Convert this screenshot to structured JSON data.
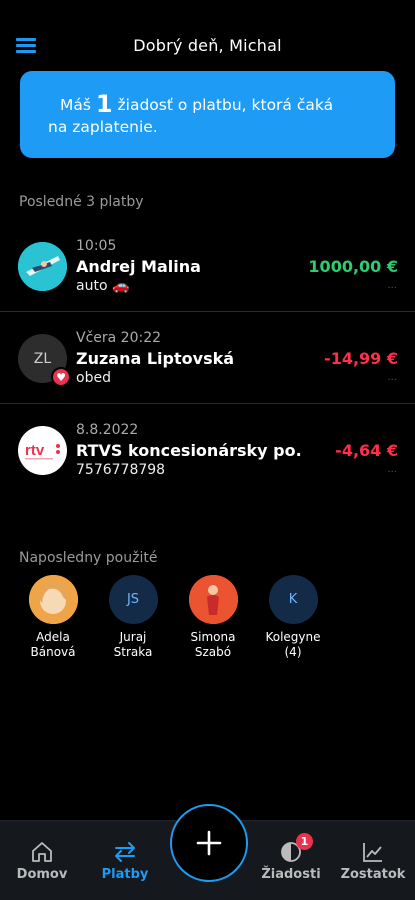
{
  "header": {
    "greeting": "Dobrý deň, Michal",
    "menu_icon": "hamburger-icon"
  },
  "banner": {
    "prefix": "Máš",
    "count": "1",
    "suffix": "žiadosť o platbu, ktorá čaká",
    "line2": "na zaplatenie."
  },
  "payments": {
    "title": "Posledné 3 platby",
    "items": [
      {
        "time": "10:05",
        "name": "Andrej Malina",
        "note": "auto 🚗",
        "amount": "1000,00 €",
        "direction": "in"
      },
      {
        "time": "Včera 20:22",
        "name": "Zuzana Liptovská",
        "note": "obed",
        "amount": "-14,99 €",
        "initials": "ZL",
        "direction": "out"
      },
      {
        "time": "8.8.2022",
        "name": "RTVS koncesionársky po.",
        "note": "7576778798",
        "amount": "-4,64 €",
        "direction": "out"
      }
    ]
  },
  "recent": {
    "title": "Naposledny použité",
    "contacts": [
      {
        "name1": "Adela",
        "name2": "Bánová"
      },
      {
        "initials": "JS",
        "name1": "Juraj",
        "name2": "Straka"
      },
      {
        "name1": "Simona",
        "name2": "Szabó"
      },
      {
        "initials": "K",
        "name1": "Kolegyne",
        "name2": "(4)"
      }
    ]
  },
  "nav": {
    "items": [
      {
        "label": "Domov",
        "icon": "home-icon"
      },
      {
        "label": "Platby",
        "icon": "transfer-arrows-icon",
        "active": true
      },
      {
        "label": "Žiadosti",
        "icon": "requests-icon",
        "badge": "1"
      },
      {
        "label": "Zostatok",
        "icon": "chart-line-icon"
      }
    ],
    "fab_icon": "plus-icon"
  },
  "colors": {
    "accent": "#1e9bf5",
    "positive": "#2ecc71",
    "negative": "#ff2f4a",
    "badge": "#e8334f"
  }
}
